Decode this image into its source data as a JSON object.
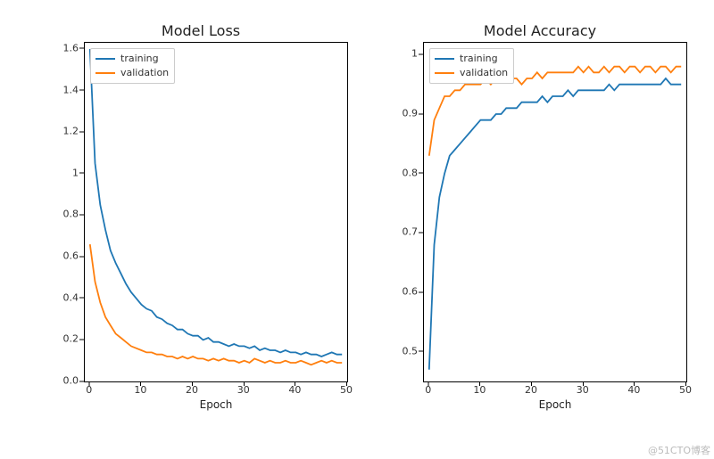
{
  "watermark": "@51CTO博客",
  "colors": {
    "training": "#1f77b4",
    "validation": "#ff7f0e"
  },
  "chart_data": [
    {
      "id": "loss",
      "type": "line",
      "title": "Model Loss",
      "xlabel": "Epoch",
      "ylabel": "",
      "xlim": [
        -1,
        50
      ],
      "ylim": [
        0.0,
        1.63
      ],
      "xticks": [
        0,
        10,
        20,
        30,
        40,
        50
      ],
      "yticks": [
        0.0,
        0.2,
        0.4,
        0.6,
        0.8,
        1.0,
        1.2,
        1.4,
        1.6
      ],
      "legend": {
        "position": "upper-left",
        "entries": [
          "training",
          "validation"
        ]
      },
      "x": [
        0,
        1,
        2,
        3,
        4,
        5,
        6,
        7,
        8,
        9,
        10,
        11,
        12,
        13,
        14,
        15,
        16,
        17,
        18,
        19,
        20,
        21,
        22,
        23,
        24,
        25,
        26,
        27,
        28,
        29,
        30,
        31,
        32,
        33,
        34,
        35,
        36,
        37,
        38,
        39,
        40,
        41,
        42,
        43,
        44,
        45,
        46,
        47,
        48,
        49
      ],
      "series": [
        {
          "name": "training",
          "values": [
            1.6,
            1.05,
            0.85,
            0.73,
            0.63,
            0.57,
            0.52,
            0.47,
            0.43,
            0.4,
            0.37,
            0.35,
            0.34,
            0.31,
            0.3,
            0.28,
            0.27,
            0.25,
            0.25,
            0.23,
            0.22,
            0.22,
            0.2,
            0.21,
            0.19,
            0.19,
            0.18,
            0.17,
            0.18,
            0.17,
            0.17,
            0.16,
            0.17,
            0.15,
            0.16,
            0.15,
            0.15,
            0.14,
            0.15,
            0.14,
            0.14,
            0.13,
            0.14,
            0.13,
            0.13,
            0.12,
            0.13,
            0.14,
            0.13,
            0.13
          ]
        },
        {
          "name": "validation",
          "values": [
            0.66,
            0.48,
            0.38,
            0.31,
            0.27,
            0.23,
            0.21,
            0.19,
            0.17,
            0.16,
            0.15,
            0.14,
            0.14,
            0.13,
            0.13,
            0.12,
            0.12,
            0.11,
            0.12,
            0.11,
            0.12,
            0.11,
            0.11,
            0.1,
            0.11,
            0.1,
            0.11,
            0.1,
            0.1,
            0.09,
            0.1,
            0.09,
            0.11,
            0.1,
            0.09,
            0.1,
            0.09,
            0.09,
            0.1,
            0.09,
            0.09,
            0.1,
            0.09,
            0.08,
            0.09,
            0.1,
            0.09,
            0.1,
            0.09,
            0.09
          ]
        }
      ]
    },
    {
      "id": "acc",
      "type": "line",
      "title": "Model Accuracy",
      "xlabel": "Epoch",
      "ylabel": "",
      "xlim": [
        -1,
        50
      ],
      "ylim": [
        0.45,
        1.02
      ],
      "xticks": [
        0,
        10,
        20,
        30,
        40,
        50
      ],
      "yticks": [
        0.5,
        0.6,
        0.7,
        0.8,
        0.9,
        1.0
      ],
      "legend": {
        "position": "upper-left",
        "entries": [
          "training",
          "validation"
        ]
      },
      "x": [
        0,
        1,
        2,
        3,
        4,
        5,
        6,
        7,
        8,
        9,
        10,
        11,
        12,
        13,
        14,
        15,
        16,
        17,
        18,
        19,
        20,
        21,
        22,
        23,
        24,
        25,
        26,
        27,
        28,
        29,
        30,
        31,
        32,
        33,
        34,
        35,
        36,
        37,
        38,
        39,
        40,
        41,
        42,
        43,
        44,
        45,
        46,
        47,
        48,
        49
      ],
      "series": [
        {
          "name": "training",
          "values": [
            0.47,
            0.68,
            0.76,
            0.8,
            0.83,
            0.84,
            0.85,
            0.86,
            0.87,
            0.88,
            0.89,
            0.89,
            0.89,
            0.9,
            0.9,
            0.91,
            0.91,
            0.91,
            0.92,
            0.92,
            0.92,
            0.92,
            0.93,
            0.92,
            0.93,
            0.93,
            0.93,
            0.94,
            0.93,
            0.94,
            0.94,
            0.94,
            0.94,
            0.94,
            0.94,
            0.95,
            0.94,
            0.95,
            0.95,
            0.95,
            0.95,
            0.95,
            0.95,
            0.95,
            0.95,
            0.95,
            0.96,
            0.95,
            0.95,
            0.95
          ]
        },
        {
          "name": "validation",
          "values": [
            0.83,
            0.89,
            0.91,
            0.93,
            0.93,
            0.94,
            0.94,
            0.95,
            0.95,
            0.95,
            0.95,
            0.96,
            0.95,
            0.96,
            0.96,
            0.96,
            0.96,
            0.96,
            0.95,
            0.96,
            0.96,
            0.97,
            0.96,
            0.97,
            0.97,
            0.97,
            0.97,
            0.97,
            0.97,
            0.98,
            0.97,
            0.98,
            0.97,
            0.97,
            0.98,
            0.97,
            0.98,
            0.98,
            0.97,
            0.98,
            0.98,
            0.97,
            0.98,
            0.98,
            0.97,
            0.98,
            0.98,
            0.97,
            0.98,
            0.98
          ]
        }
      ]
    }
  ]
}
